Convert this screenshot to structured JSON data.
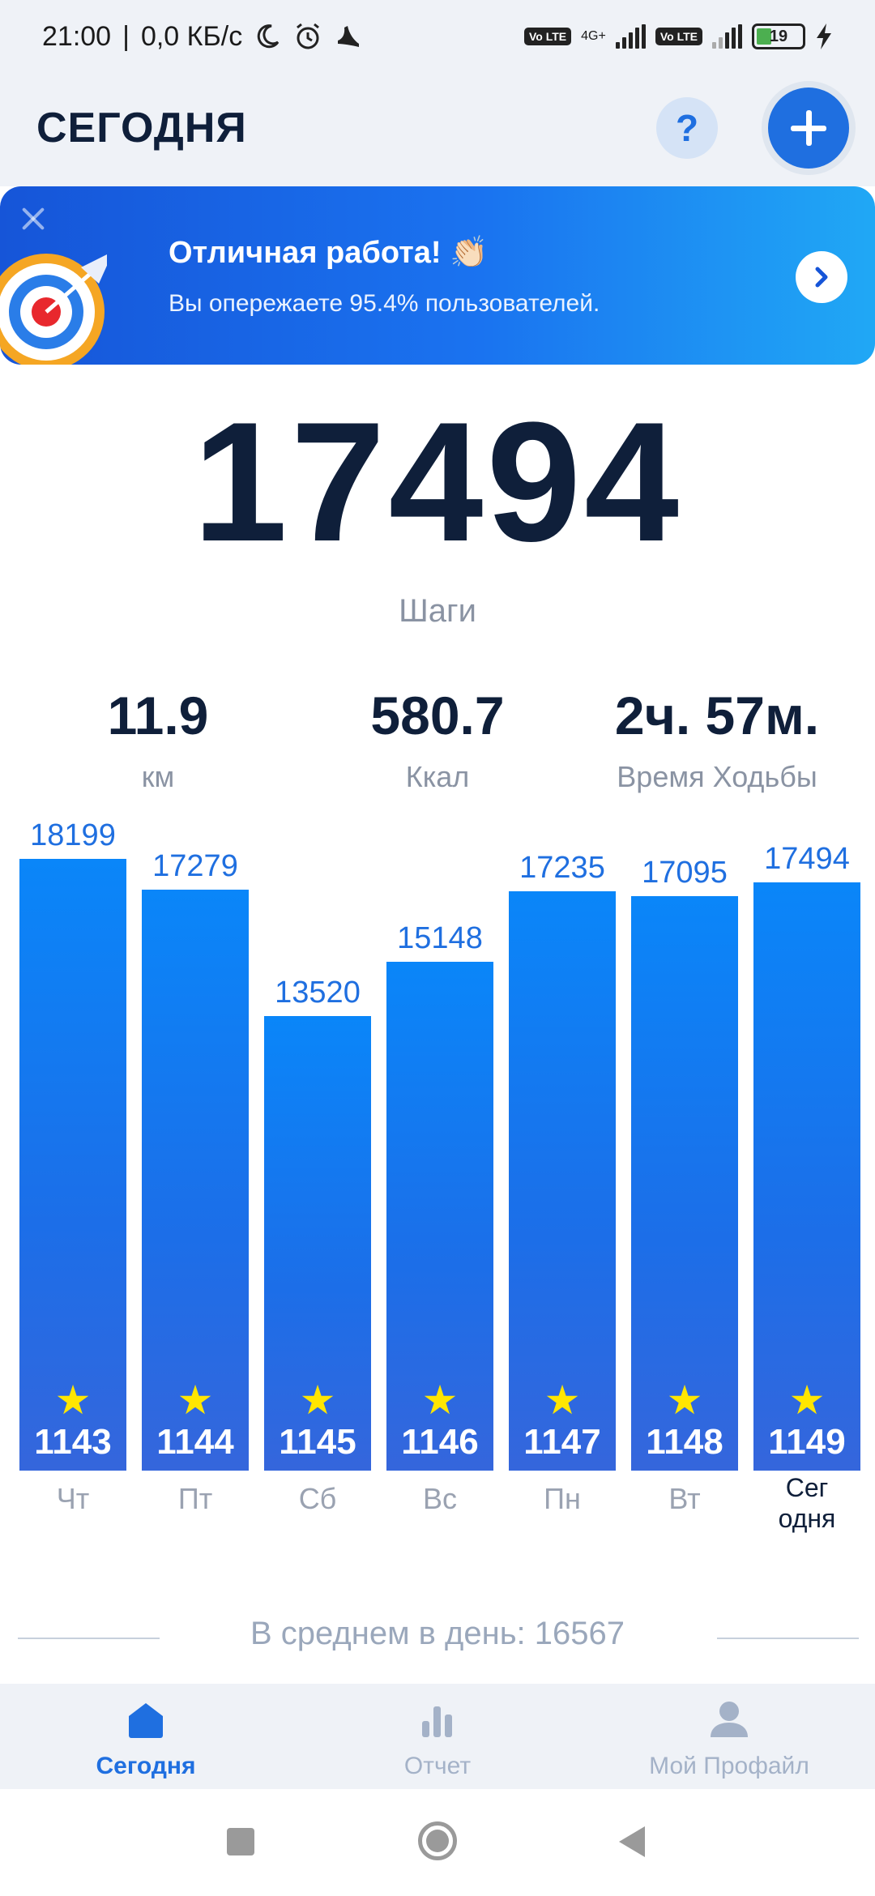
{
  "status_bar": {
    "time": "21:00",
    "speed": "0,0 КБ/с",
    "network": "4G+",
    "volte": "Vo LTE",
    "battery": "19"
  },
  "header": {
    "title": "СЕГОДНЯ",
    "help_label": "?"
  },
  "banner": {
    "title": "Отличная работа! 👏🏻",
    "subtitle": "Вы опережаете 95.4% пользователей."
  },
  "steps": {
    "value": "17494",
    "label": "Шаги"
  },
  "stats": [
    {
      "value": "11.9",
      "label": "км"
    },
    {
      "value": "580.7",
      "label": "Ккал"
    },
    {
      "value": "2ч. 57м.",
      "label": "Время Ходьбы"
    }
  ],
  "chart_data": {
    "type": "bar",
    "categories": [
      "Чт",
      "Пт",
      "Сб",
      "Вс",
      "Пн",
      "Вт",
      "Сег одня"
    ],
    "values": [
      18199,
      17279,
      13520,
      15148,
      17235,
      17095,
      17494
    ],
    "value_labels": [
      "18199",
      "17279",
      "13520",
      "15148",
      "17235",
      "17095",
      "17494"
    ],
    "day_numbers": [
      "1143",
      "1144",
      "1145",
      "1146",
      "1147",
      "1148",
      "1149"
    ],
    "today_label_lines": [
      "Сег",
      "одня"
    ],
    "title": "",
    "xlabel": "",
    "ylabel": "",
    "ylim": [
      0,
      18199
    ],
    "bar_color": "#1c6ee8",
    "label_color": "#1f6fe0"
  },
  "average": "В среднем в день: 16567",
  "bottom_nav": [
    {
      "label": "Сегодня",
      "icon": "home-icon",
      "active": true
    },
    {
      "label": "Отчет",
      "icon": "bar-chart-icon",
      "active": false
    },
    {
      "label": "Мой Профайл",
      "icon": "profile-icon",
      "active": false
    }
  ],
  "colors": {
    "accent": "#1f6fe0",
    "dark_text": "#0f1f3a",
    "muted_text": "#8a93a3",
    "background": "#eff2f7"
  }
}
